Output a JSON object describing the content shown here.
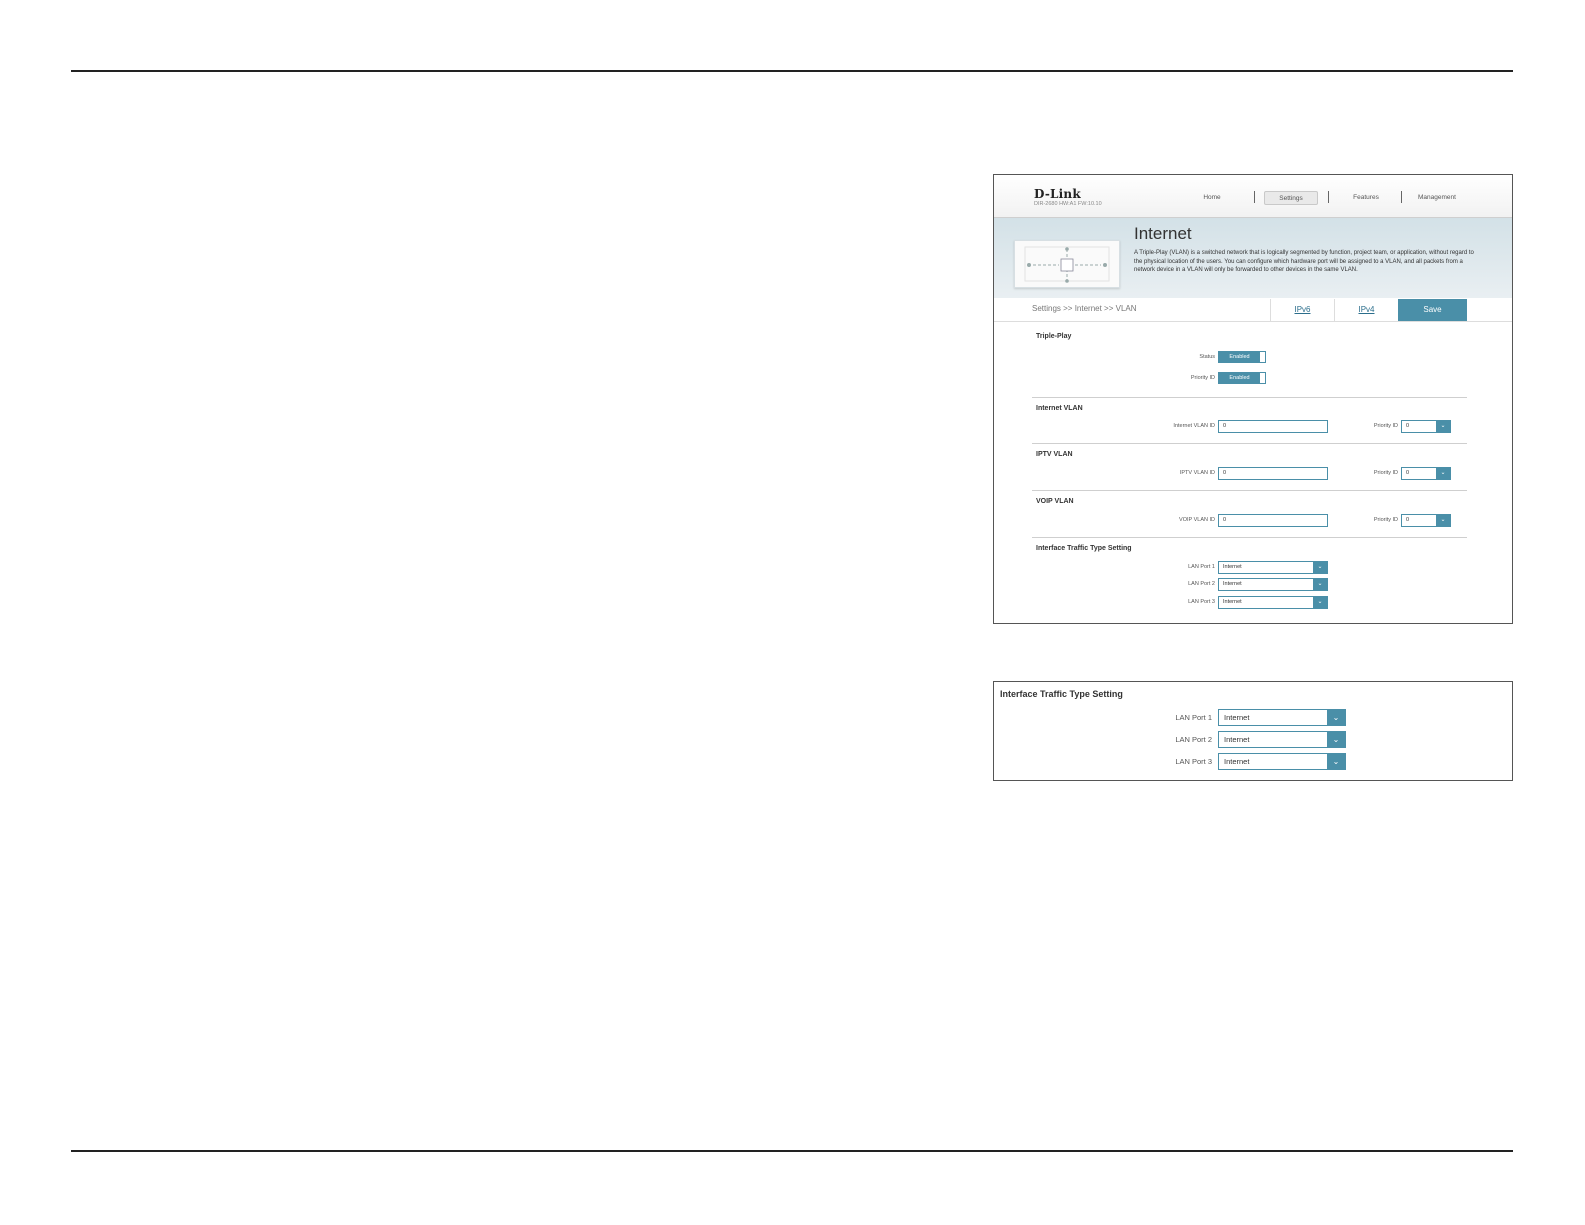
{
  "router": {
    "logo": "D-Link",
    "model": "DIR-2680 HW:A1 FW:10.10",
    "nav": [
      "Home",
      "Settings",
      "Features",
      "Management"
    ],
    "active_nav": "Settings"
  },
  "hero": {
    "title": "Internet",
    "description": "A Triple-Play (VLAN) is a switched network that is logically segmented by function, project team, or application, without regard to the physical location of the users. You can configure which hardware port will be assigned to a VLAN, and all packets from a network device in a VLAN will only be forwarded to other devices in the same VLAN."
  },
  "breadcrumb": "Settings >> Internet >> VLAN",
  "tabs": {
    "ipv6": "IPv6",
    "ipv4": "IPv4",
    "save": "Save"
  },
  "triple_play": {
    "title": "Triple-Play",
    "status_label": "Status",
    "status_value": "Enabled",
    "priority_label": "Priority ID",
    "priority_value": "Enabled"
  },
  "internet_vlan": {
    "title": "Internet VLAN",
    "id_label": "Internet VLAN ID",
    "id_value": "0",
    "priority_label": "Priority ID",
    "priority_value": "0"
  },
  "iptv_vlan": {
    "title": "IPTV VLAN",
    "id_label": "IPTV VLAN ID",
    "id_value": "0",
    "priority_label": "Priority ID",
    "priority_value": "0"
  },
  "voip_vlan": {
    "title": "VOIP VLAN",
    "id_label": "VOIP VLAN ID",
    "id_value": "0",
    "priority_label": "Priority ID",
    "priority_value": "0"
  },
  "interface": {
    "title": "Interface Traffic Type Setting",
    "ports": [
      {
        "label": "LAN Port 1",
        "value": "Internet"
      },
      {
        "label": "LAN Port 2",
        "value": "Internet"
      },
      {
        "label": "LAN Port 3",
        "value": "Internet"
      }
    ]
  },
  "icons": {
    "dropdown": "chevron-down-icon"
  },
  "colors": {
    "accent": "#4a8fa8"
  }
}
